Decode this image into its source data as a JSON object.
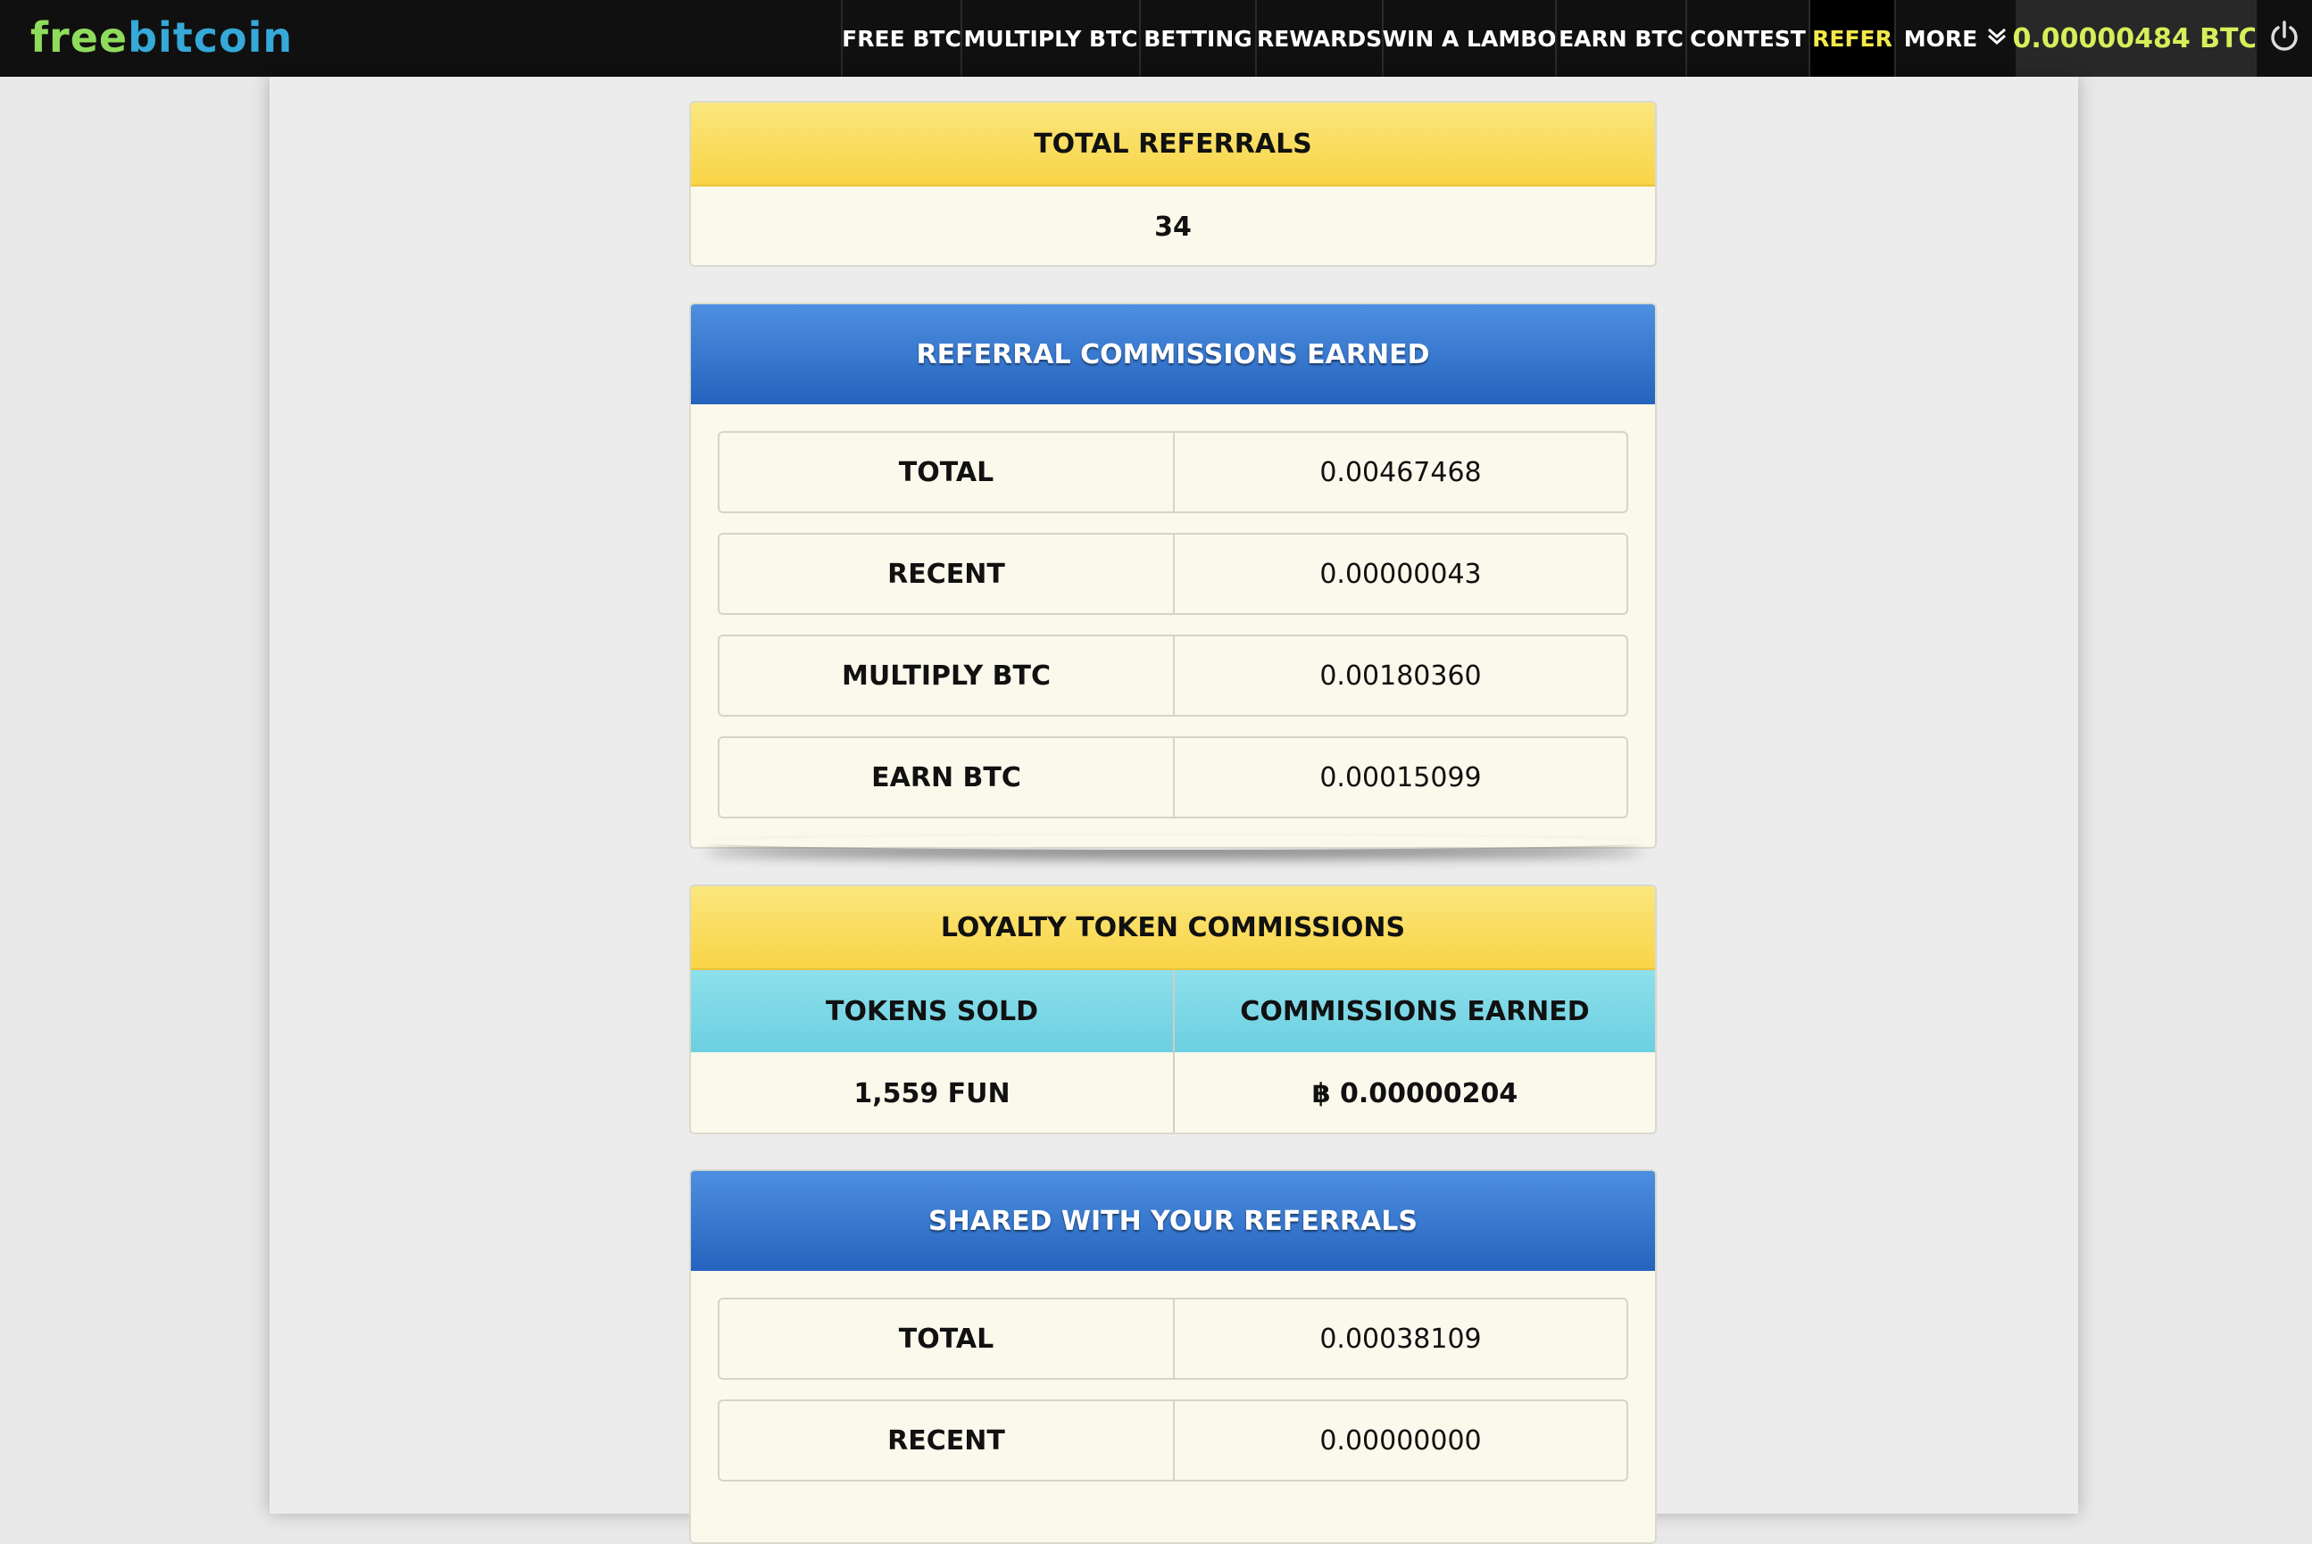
{
  "header": {
    "logo_free": "free",
    "logo_bitcoin": "bitcoin",
    "nav": [
      "FREE BTC",
      "MULTIPLY BTC",
      "BETTING",
      "REWARDS",
      "WIN A LAMBO",
      "EARN BTC",
      "CONTEST",
      "REFER",
      "MORE"
    ],
    "active_nav": "REFER",
    "balance": "0.00000484 BTC"
  },
  "total_referrals": {
    "title": "TOTAL REFERRALS",
    "value": "34"
  },
  "commissions": {
    "title": "REFERRAL COMMISSIONS EARNED",
    "rows": [
      {
        "label": "TOTAL",
        "value": "0.00467468"
      },
      {
        "label": "RECENT",
        "value": "0.00000043"
      },
      {
        "label": "MULTIPLY BTC",
        "value": "0.00180360"
      },
      {
        "label": "EARN BTC",
        "value": "0.00015099"
      }
    ]
  },
  "loyalty": {
    "title": "LOYALTY TOKEN COMMISSIONS",
    "col1": "TOKENS SOLD",
    "col2": "COMMISSIONS EARNED",
    "tokens_sold": "1,559 FUN",
    "commissions_earned": "฿ 0.00000204"
  },
  "shared": {
    "title": "SHARED WITH YOUR REFERRALS",
    "rows": [
      {
        "label": "TOTAL",
        "value": "0.00038109"
      },
      {
        "label": "RECENT",
        "value": "0.00000000"
      }
    ]
  },
  "colors": {
    "topbar": "#101010",
    "logo_free": "#8fdc5c",
    "logo_bitcoin": "#35a9d8",
    "active_nav": "#f3e94a",
    "balance": "#d8ee5a",
    "yellow_header": "#f9d446",
    "blue_header": "#2563be",
    "cyan_header": "#6ccfe0"
  }
}
